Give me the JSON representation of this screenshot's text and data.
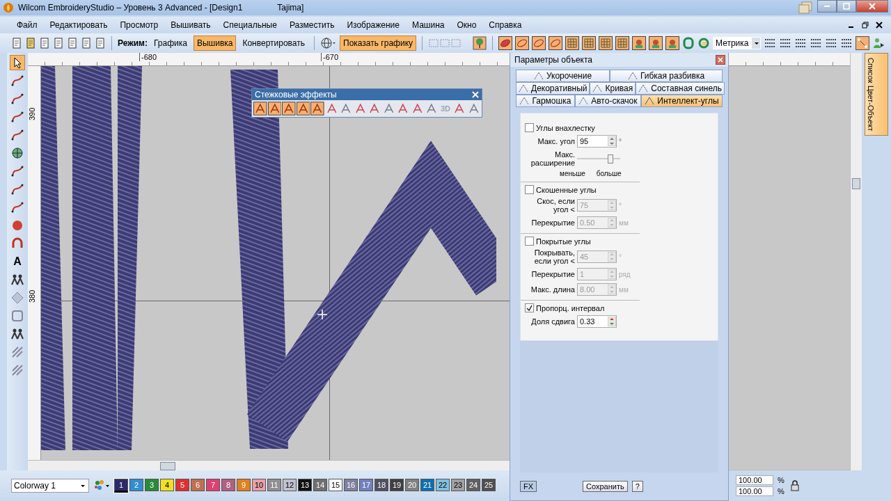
{
  "window": {
    "title": "Wilcom EmbroideryStudio – Уровень 3 Advanced - [Design1",
    "title_extra": "Tajima]"
  },
  "menu": [
    "Файл",
    "Редактировать",
    "Просмотр",
    "Вышивать",
    "Специальные",
    "Разместить",
    "Изображение",
    "Машина",
    "Окно",
    "Справка"
  ],
  "toolbar": {
    "mode_label": "Режим:",
    "modes": [
      {
        "label": "Графика",
        "selected": false
      },
      {
        "label": "Вышивка",
        "selected": true
      },
      {
        "label": "Конвертировать",
        "selected": false
      }
    ],
    "show_graphics": {
      "label": "Показать графику",
      "on": true
    },
    "stitch_types": [
      {
        "on": true
      },
      {
        "on": true
      },
      {
        "on": true
      },
      {
        "on": true
      },
      {
        "on": true
      },
      {
        "on": true
      },
      {
        "on": true
      },
      {
        "on": true
      },
      {
        "on": true
      },
      {
        "on": true
      },
      {
        "on": true
      }
    ],
    "units": "Метрика"
  },
  "rulers": {
    "x_labels": [
      "-680",
      "-670"
    ],
    "y_labels": [
      "390",
      "380"
    ]
  },
  "left_toolbar": {
    "text_tool_glyph": "A"
  },
  "stitch_effects": {
    "title": "Стежковые эффекты",
    "effects": [
      {
        "kind": "icon",
        "on": true
      },
      {
        "kind": "icon",
        "on": true
      },
      {
        "kind": "icon",
        "on": true
      },
      {
        "kind": "icon",
        "on": true
      },
      {
        "kind": "icon",
        "on": true
      },
      {
        "kind": "icon",
        "on": false
      },
      {
        "kind": "icon",
        "on": false
      },
      {
        "kind": "icon",
        "on": false
      },
      {
        "kind": "icon",
        "on": false
      },
      {
        "kind": "icon",
        "on": false
      },
      {
        "kind": "icon",
        "on": false
      },
      {
        "kind": "icon",
        "on": false
      },
      {
        "kind": "icon",
        "on": false
      },
      {
        "kind": "text",
        "label": "3D",
        "on": false
      },
      {
        "kind": "icon",
        "on": false
      },
      {
        "kind": "icon",
        "on": false
      }
    ]
  },
  "object_properties": {
    "title": "Параметры объекта",
    "tab_rows": [
      [
        {
          "label": "Укорочение",
          "selected": false
        },
        {
          "label": "Гибкая разбивка",
          "selected": false
        }
      ],
      [
        {
          "label": "Декоративный",
          "selected": false
        },
        {
          "label": "Кривая",
          "selected": false
        },
        {
          "label": "Составная синель",
          "selected": false
        }
      ],
      [
        {
          "label": "Гармошка",
          "selected": false
        },
        {
          "label": "Авто-скачок",
          "selected": false
        },
        {
          "label": "Интеллект-углы",
          "selected": true
        }
      ]
    ],
    "sections": [
      {
        "checkbox": {
          "label": "Углы внахлестку",
          "checked": false
        },
        "fields": [
          {
            "kind": "spin",
            "label": "Макс. угол",
            "value": "95",
            "unit": "°",
            "disabled": false
          },
          {
            "kind": "slider",
            "label": "Макс. расширение",
            "level": 0.75,
            "min_label": "меньше",
            "max_label": "больше"
          }
        ]
      },
      {
        "checkbox": {
          "label": "Скошенные углы",
          "checked": false
        },
        "fields": [
          {
            "kind": "spin",
            "label": "Скос, если угол <",
            "value": "75",
            "unit": "°",
            "disabled": true
          },
          {
            "kind": "spin",
            "label": "Перекрытие",
            "value": "0.50",
            "unit": "мм",
            "disabled": true
          }
        ]
      },
      {
        "checkbox": {
          "label": "Покрытые углы",
          "checked": false
        },
        "fields": [
          {
            "kind": "spin",
            "label": "Покрывать, если угол <",
            "value": "45",
            "unit": "°",
            "disabled": true
          },
          {
            "kind": "spin",
            "label": "Перекрытие",
            "value": "1",
            "unit": "ряд",
            "disabled": true
          },
          {
            "kind": "spin",
            "label": "Макс. длина",
            "value": "8.00",
            "unit": "мм",
            "disabled": true
          }
        ]
      },
      {
        "checkbox": {
          "label": "Пропорц. интервал",
          "checked": true
        },
        "fields": [
          {
            "kind": "spin",
            "label": "Доля сдвига",
            "value": "0.33",
            "disabled": false
          }
        ]
      }
    ],
    "buttons": [
      "FX",
      "Сохранить",
      "?"
    ]
  },
  "side_tab": "Список Цвет-Объект",
  "zoom": [
    {
      "value": "100.00",
      "unit": "%"
    },
    {
      "value": "100.00",
      "unit": "%"
    }
  ],
  "colorway": {
    "value": "Colorway 1"
  },
  "colors": [
    {
      "label": "1",
      "color": "#2a2a6a",
      "selected": true
    },
    {
      "label": "2",
      "color": "#2f8fd0",
      "selected": false
    },
    {
      "label": "3",
      "color": "#2a8a3a",
      "selected": false
    },
    {
      "label": "4",
      "color": "#f0e020",
      "selected": false
    },
    {
      "label": "5",
      "color": "#e03030",
      "selected": false
    },
    {
      "label": "6",
      "color": "#c07050",
      "selected": false
    },
    {
      "label": "7",
      "color": "#e04070",
      "selected": false
    },
    {
      "label": "8",
      "color": "#b06080",
      "selected": false
    },
    {
      "label": "9",
      "color": "#e08020",
      "selected": false
    },
    {
      "label": "10",
      "color": "#e8a0a8",
      "selected": false
    },
    {
      "label": "11",
      "color": "#909090",
      "selected": false
    },
    {
      "label": "12",
      "color": "#c0c0d0",
      "selected": false
    },
    {
      "label": "13",
      "color": "#101010",
      "selected": false
    },
    {
      "label": "14",
      "color": "#707070",
      "selected": false
    },
    {
      "label": "15",
      "color": "#ffffff",
      "selected": false
    },
    {
      "label": "16",
      "color": "#8080a0",
      "selected": false
    },
    {
      "label": "17",
      "color": "#7080c0",
      "selected": false
    },
    {
      "label": "18",
      "color": "#505060",
      "selected": false
    },
    {
      "label": "19",
      "color": "#404040",
      "selected": false
    },
    {
      "label": "20",
      "color": "#808080",
      "selected": false
    },
    {
      "label": "21",
      "color": "#1070b0",
      "selected": false
    },
    {
      "label": "22",
      "color": "#80c0e0",
      "selected": false
    },
    {
      "label": "23",
      "color": "#a0a0a0",
      "selected": false
    },
    {
      "label": "24",
      "color": "#606060",
      "selected": false
    },
    {
      "label": "25",
      "color": "#505050",
      "selected": false
    }
  ]
}
